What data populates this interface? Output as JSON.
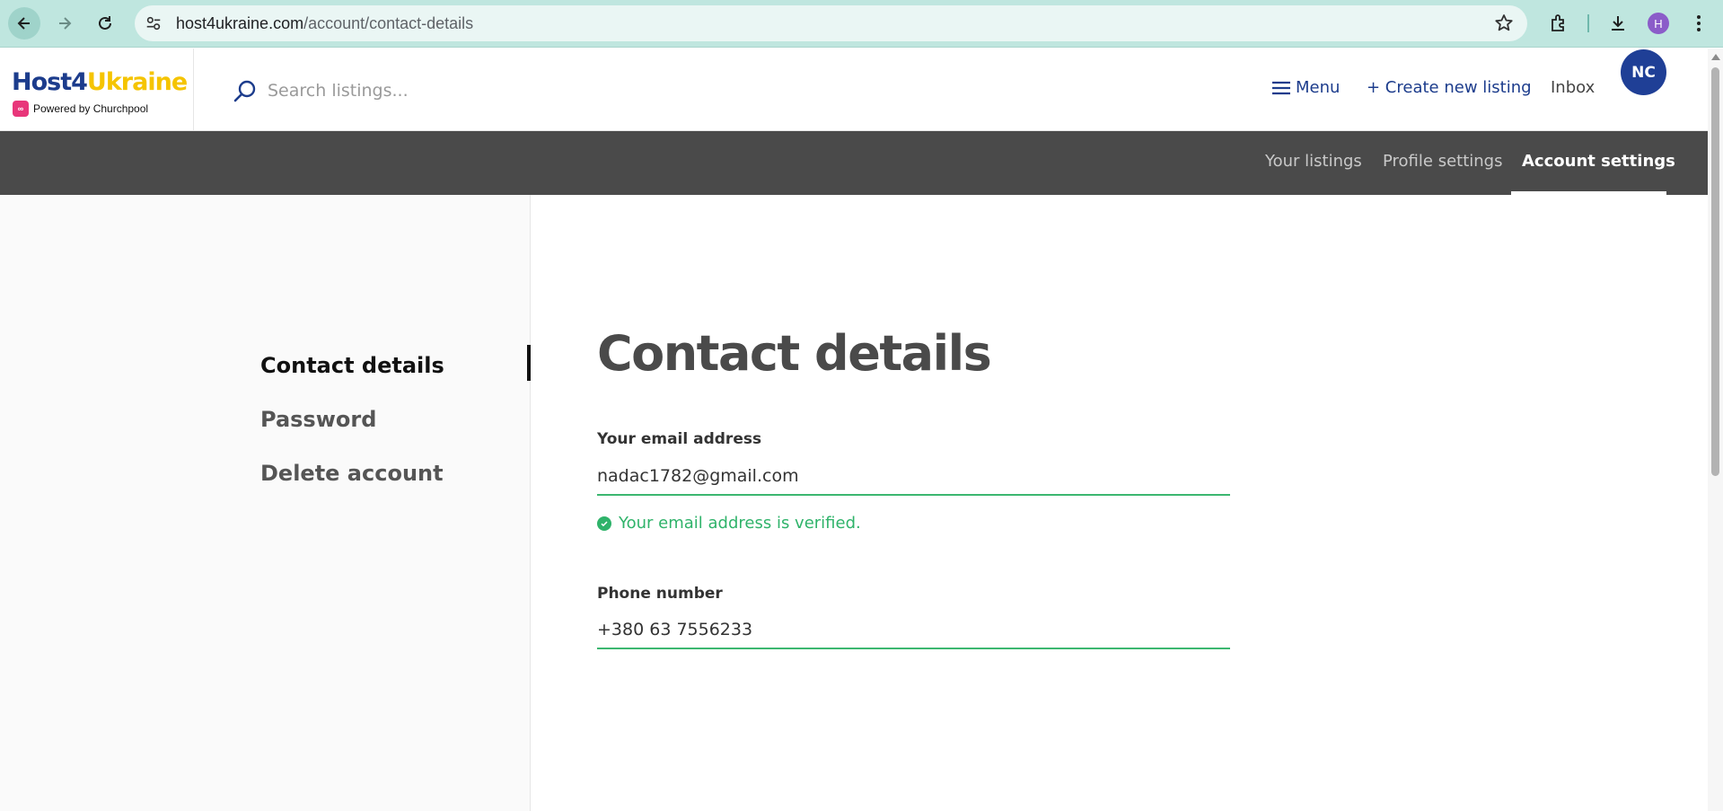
{
  "browser": {
    "url_domain": "host4ukraine.com",
    "url_path": "/account/contact-details",
    "profile_initial": "H"
  },
  "header": {
    "logo_part1": "Host4",
    "logo_part2": "Ukraine",
    "logo_sub": "Powered by Churchpool",
    "search_placeholder": "Search listings...",
    "menu_label": "Menu",
    "create_label": "+ Create new listing",
    "inbox_label": "Inbox",
    "avatar_initials": "NC"
  },
  "subnav": {
    "tabs": [
      {
        "label": "Your listings"
      },
      {
        "label": "Profile settings"
      },
      {
        "label": "Account settings",
        "active": true
      }
    ]
  },
  "sidebar": {
    "items": [
      {
        "label": "Contact details",
        "active": true
      },
      {
        "label": "Password"
      },
      {
        "label": "Delete account"
      }
    ]
  },
  "main": {
    "title": "Contact details",
    "email_label": "Your email address",
    "email_value": "nadac1782@gmail.com",
    "verified_text": "Your email address is verified.",
    "phone_label": "Phone number",
    "phone_value": "+380 63 7556233"
  },
  "colors": {
    "brand_blue": "#1c3c8c",
    "brand_yellow": "#f5c400",
    "success_green": "#2fb36a",
    "subnav_bg": "#4a4a4a"
  }
}
